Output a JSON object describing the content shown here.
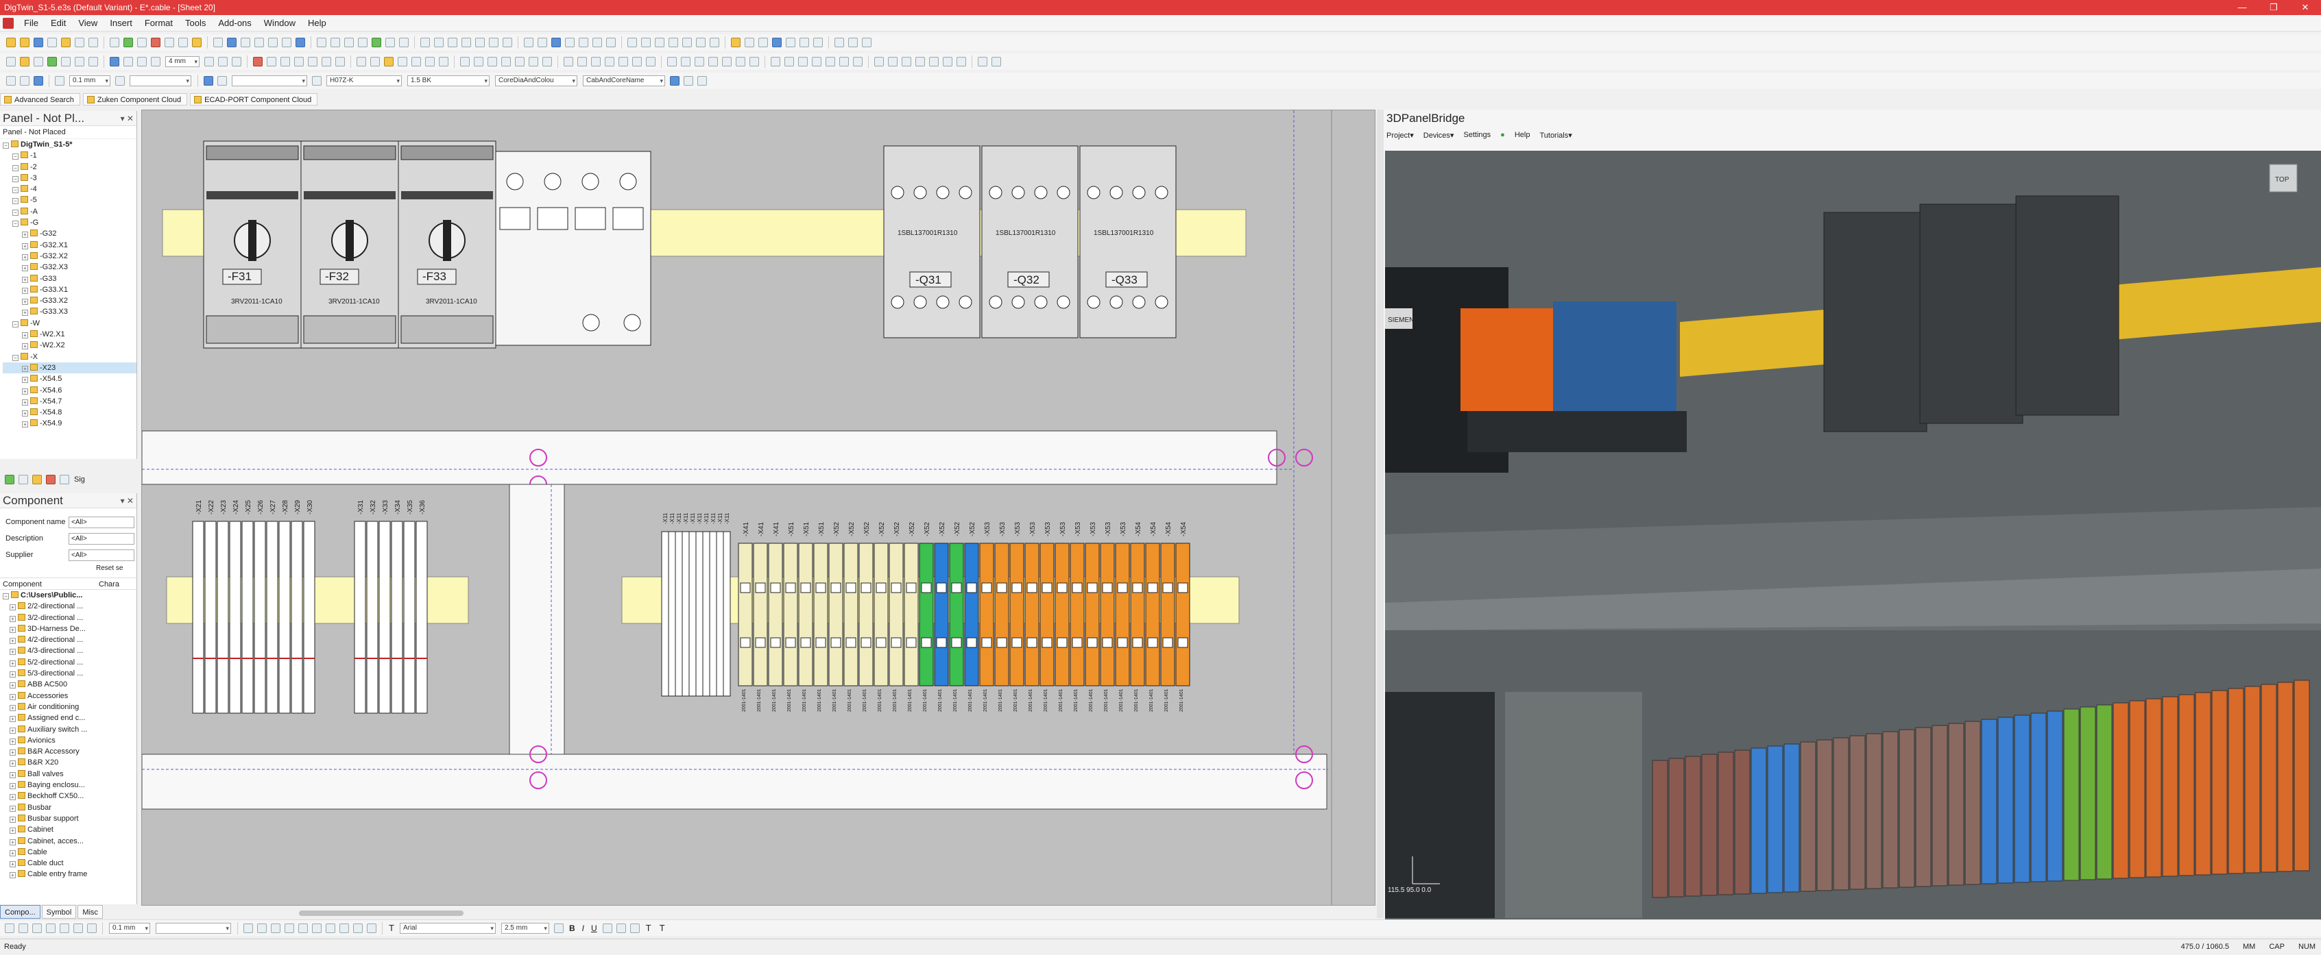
{
  "window": {
    "title": "DigTwin_S1-5.e3s (Default Variant) - E*.cable - [Sheet 20]",
    "controls": [
      "—",
      "❐",
      "✕"
    ]
  },
  "menu": [
    "File",
    "Edit",
    "View",
    "Insert",
    "Format",
    "Tools",
    "Add-ons",
    "Window",
    "Help"
  ],
  "toolbar": {
    "line_width_1": "4 mm",
    "line_width_2": "0.1 mm",
    "cable_type": "H07Z-K",
    "cross_section": "1.5 BK",
    "core_color": "CoreDiaAndColou",
    "core_name": "CabAndCoreName"
  },
  "search_tabs": [
    "Advanced Search",
    "Zuken Component Cloud",
    "ECAD-PORT Component Cloud"
  ],
  "panel": {
    "title": "Panel - Not Pl...",
    "subtitle": "Panel - Not Placed",
    "tree": [
      {
        "label": "DigTwin_S1-5*",
        "level": 0,
        "bold": true
      },
      {
        "label": "-1",
        "level": 1
      },
      {
        "label": "-2",
        "level": 1
      },
      {
        "label": "-3",
        "level": 1
      },
      {
        "label": "-4",
        "level": 1
      },
      {
        "label": "-5",
        "level": 1
      },
      {
        "label": "-A",
        "level": 1
      },
      {
        "label": "-G",
        "level": 1
      },
      {
        "label": "-G32",
        "level": 2
      },
      {
        "label": "-G32.X1",
        "level": 2
      },
      {
        "label": "-G32.X2",
        "level": 2
      },
      {
        "label": "-G32.X3",
        "level": 2
      },
      {
        "label": "-G33",
        "level": 2
      },
      {
        "label": "-G33.X1",
        "level": 2
      },
      {
        "label": "-G33.X2",
        "level": 2
      },
      {
        "label": "-G33.X3",
        "level": 2
      },
      {
        "label": "-W",
        "level": 1
      },
      {
        "label": "-W2.X1",
        "level": 2
      },
      {
        "label": "-W2.X2",
        "level": 2
      },
      {
        "label": "-X",
        "level": 1
      },
      {
        "label": "-X23",
        "level": 2,
        "selected": true
      },
      {
        "label": "-X54.5",
        "level": 2
      },
      {
        "label": "-X54.6",
        "level": 2
      },
      {
        "label": "-X54.7",
        "level": 2
      },
      {
        "label": "-X54.8",
        "level": 2
      },
      {
        "label": "-X54.9",
        "level": 2
      }
    ],
    "tabs_label": "Sig"
  },
  "component": {
    "title": "Component",
    "filters": [
      {
        "label": "Component name",
        "value": "<All>"
      },
      {
        "label": "Description",
        "value": "<All>"
      },
      {
        "label": "Supplier",
        "value": "<All>"
      }
    ],
    "reset_label": "Reset se",
    "col1": "Component",
    "col2": "Chara",
    "items": [
      "C:\\Users\\Public...",
      "2/2-directional ...",
      "3/2-directional ...",
      "3D-Harness De...",
      "4/2-directional ...",
      "4/3-directional ...",
      "5/2-directional ...",
      "5/3-directional ...",
      "ABB AC500",
      "Accessories",
      "Air conditioning",
      "Assigned end c...",
      "Auxiliary switch ...",
      "Avionics",
      "B&R Accessory",
      "B&R X20",
      "Ball valves",
      "Baying enclosu...",
      "Beckhoff CX50...",
      "Busbar",
      "Busbar support",
      "Cabinet",
      "Cabinet, acces...",
      "Cable",
      "Cable duct",
      "Cable entry frame"
    ]
  },
  "bottom_tabs": [
    "Compo...",
    "Symbol",
    "Misc"
  ],
  "drawing": {
    "breakers": [
      {
        "tag": "-F31",
        "part": "3RV2011-1CA10"
      },
      {
        "tag": "-F32",
        "part": "3RV2011-1CA10"
      },
      {
        "tag": "-F33",
        "part": "3RV2011-1CA10"
      }
    ],
    "contactors": [
      {
        "tag": "-Q31",
        "part": "1SBL137001R1310"
      },
      {
        "tag": "-Q32",
        "part": "1SBL137001R1310"
      },
      {
        "tag": "-Q33",
        "part": "1SBL137001R1310"
      }
    ],
    "terminal_groups": [
      {
        "labels": [
          "-X21",
          "-X22",
          "-X23",
          "-X24",
          "-X25",
          "-X26",
          "-X27",
          "-X28",
          "-X29",
          "-X30"
        ]
      },
      {
        "labels": [
          "-X31",
          "-X32",
          "-X33",
          "-X34",
          "-X35",
          "-X36"
        ]
      }
    ],
    "terminal_part": "2001-1401",
    "strip_labels_a": [
      "-X11",
      "-X11",
      "-X11",
      "-X11",
      "-X11",
      "-X11",
      "-X11",
      "-X11",
      "-X11",
      "-X11"
    ],
    "strip_labels_b": [
      "-X41",
      "-X41",
      "-X41",
      "-X51",
      "-X51",
      "-X51",
      "-X52",
      "-X52",
      "-X52",
      "-X52",
      "-X52",
      "-X52",
      "-X52",
      "-X52",
      "-X52",
      "-X52",
      "-X53",
      "-X53",
      "-X53",
      "-X53",
      "-X53",
      "-X53",
      "-X53",
      "-X53",
      "-X53",
      "-X53",
      "-X54",
      "-X54",
      "-X54",
      "-X54"
    ]
  },
  "bridge": {
    "title": "3DPanelBridge",
    "menu": [
      "Project▾",
      "Devices▾",
      "Settings",
      "Help",
      "Tutorials▾"
    ],
    "coords": "115.5   95.0   0.0",
    "brand": "SIEMENS",
    "view_cube": "TOP"
  },
  "format": {
    "font": "Arial",
    "font_size": "2.5 mm",
    "line": "0.1 mm"
  },
  "status": {
    "left": "Ready",
    "coords": "475.0 / 1060.5",
    "units": "MM",
    "caps": "CAP",
    "num": "NUM"
  }
}
